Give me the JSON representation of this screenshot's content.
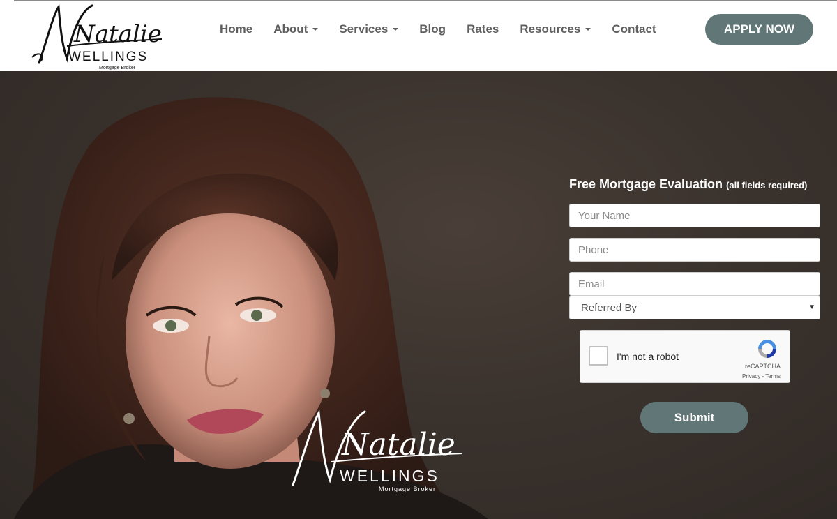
{
  "brand": {
    "script_name": "Natalie",
    "surname": "WELLINGS",
    "tagline": "Mortgage Broker"
  },
  "nav": {
    "items": [
      {
        "label": "Home",
        "dropdown": false
      },
      {
        "label": "About",
        "dropdown": true
      },
      {
        "label": "Services",
        "dropdown": true
      },
      {
        "label": "Blog",
        "dropdown": false
      },
      {
        "label": "Rates",
        "dropdown": false
      },
      {
        "label": "Resources",
        "dropdown": true
      },
      {
        "label": "Contact",
        "dropdown": false
      }
    ],
    "apply_label": "APPLY NOW"
  },
  "form": {
    "title": "Free Mortgage Evaluation",
    "note": "(all fields required)",
    "name_placeholder": "Your Name",
    "phone_placeholder": "Phone",
    "email_placeholder": "Email",
    "referred_value": "Referred By",
    "submit_label": "Submit"
  },
  "recaptcha": {
    "label": "I'm not a robot",
    "brand": "reCAPTCHA",
    "terms": "Privacy - Terms"
  },
  "colors": {
    "accent": "#617676",
    "nav_text": "#5f5f5f",
    "hero_bg": "#3a322d"
  }
}
